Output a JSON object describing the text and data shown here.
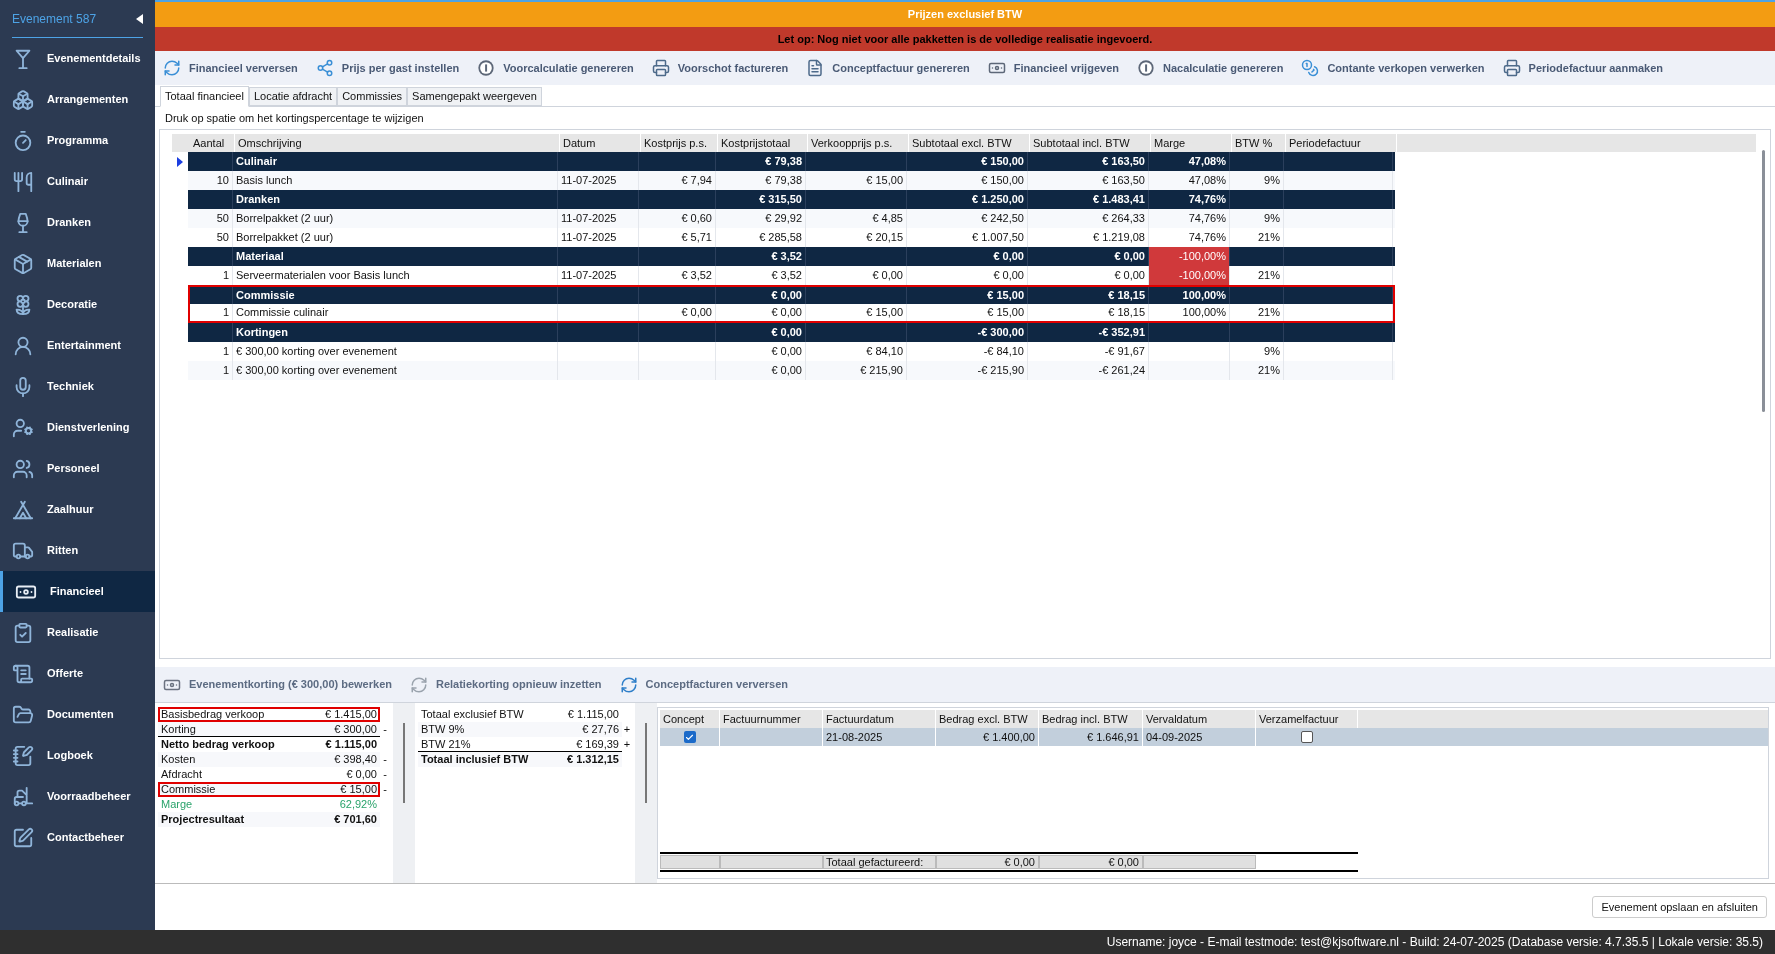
{
  "banner": {
    "title": "Prijzen exclusief BTW"
  },
  "warning": "Let op: Nog niet voor alle pakketten is de volledige realisatie ingevoerd.",
  "sidebar": {
    "title": "Evenement 587",
    "items": [
      {
        "label": "Evenementdetails",
        "selected": false
      },
      {
        "label": "Arrangementen",
        "selected": false
      },
      {
        "label": "Programma",
        "selected": false
      },
      {
        "label": "Culinair",
        "selected": false
      },
      {
        "label": "Dranken",
        "selected": false
      },
      {
        "label": "Materialen",
        "selected": false
      },
      {
        "label": "Decoratie",
        "selected": false
      },
      {
        "label": "Entertainment",
        "selected": false
      },
      {
        "label": "Techniek",
        "selected": false
      },
      {
        "label": "Dienstverlening",
        "selected": false
      },
      {
        "label": "Personeel",
        "selected": false
      },
      {
        "label": "Zaalhuur",
        "selected": false
      },
      {
        "label": "Ritten",
        "selected": false
      },
      {
        "label": "Financieel",
        "selected": true
      },
      {
        "label": "Realisatie",
        "selected": false
      },
      {
        "label": "Offerte",
        "selected": false
      },
      {
        "label": "Documenten",
        "selected": false
      },
      {
        "label": "Logboek",
        "selected": false
      },
      {
        "label": "Voorraadbeheer",
        "selected": false
      },
      {
        "label": "Contactbeheer",
        "selected": false
      }
    ]
  },
  "toolbar": [
    "Financieel verversen",
    "Prijs per gast instellen",
    "Voorcalculatie genereren",
    "Voorschot factureren",
    "Conceptfactuur genereren",
    "Financieel vrijgeven",
    "Nacalculatie genereren",
    "Contante verkopen verwerken",
    "Periodefactuur aanmaken"
  ],
  "tabs": [
    {
      "label": "Totaal financieel",
      "selected": true
    },
    {
      "label": "Locatie afdracht",
      "selected": false
    },
    {
      "label": "Commissies",
      "selected": false
    },
    {
      "label": "Samengepakt weergeven",
      "selected": false
    }
  ],
  "hint": "Druk op spatie om het kortingspercentage te wijzigen",
  "table": {
    "columns": [
      "Aantal",
      "Omschrijving",
      "Datum",
      "Kostprijs p.s.",
      "Kostprijstotaal",
      "Verkoopprijs p.s.",
      "Subtotaal excl. BTW",
      "Subtotaal incl. BTW",
      "Marge",
      "BTW %",
      "Periodefactuur"
    ],
    "rows": [
      {
        "kind": "group",
        "current": true,
        "outlined": false,
        "marge_alert": false,
        "cells": [
          null,
          "Culinair",
          null,
          null,
          "€ 79,38",
          null,
          "€ 150,00",
          "€ 163,50",
          "47,08%",
          null,
          null
        ]
      },
      {
        "kind": "item",
        "current": false,
        "outlined": false,
        "marge_alert": false,
        "cells": [
          "10",
          "Basis lunch",
          "11-07-2025",
          "€ 7,94",
          "€ 79,38",
          "€ 15,00",
          "€ 150,00",
          "€ 163,50",
          "47,08%",
          "9%",
          null
        ]
      },
      {
        "kind": "group",
        "current": false,
        "outlined": false,
        "marge_alert": false,
        "cells": [
          null,
          "Dranken",
          null,
          null,
          "€ 315,50",
          null,
          "€ 1.250,00",
          "€ 1.483,41",
          "74,76%",
          null,
          null
        ]
      },
      {
        "kind": "item",
        "current": false,
        "outlined": false,
        "marge_alert": false,
        "cells": [
          "50",
          "Borrelpakket (2 uur)",
          "11-07-2025",
          "€ 0,60",
          "€ 29,92",
          "€ 4,85",
          "€ 242,50",
          "€ 264,33",
          "74,76%",
          "9%",
          null
        ]
      },
      {
        "kind": "item",
        "current": false,
        "outlined": false,
        "marge_alert": false,
        "cells": [
          "50",
          "Borrelpakket (2 uur)",
          "11-07-2025",
          "€ 5,71",
          "€ 285,58",
          "€ 20,15",
          "€ 1.007,50",
          "€ 1.219,08",
          "74,76%",
          "21%",
          null
        ]
      },
      {
        "kind": "group",
        "current": false,
        "outlined": false,
        "marge_alert": true,
        "cells": [
          null,
          "Materiaal",
          null,
          null,
          "€ 3,52",
          null,
          "€ 0,00",
          "€ 0,00",
          "-100,00%",
          null,
          null
        ]
      },
      {
        "kind": "item",
        "current": false,
        "outlined": false,
        "marge_alert": true,
        "cells": [
          "1",
          "Serveermaterialen voor Basis lunch",
          "11-07-2025",
          "€ 3,52",
          "€ 3,52",
          "€ 0,00",
          "€ 0,00",
          "€ 0,00",
          "-100,00%",
          "21%",
          null
        ]
      },
      {
        "kind": "group",
        "current": false,
        "outlined": true,
        "marge_alert": false,
        "cells": [
          null,
          "Commissie",
          null,
          null,
          "€ 0,00",
          null,
          "€ 15,00",
          "€ 18,15",
          "100,00%",
          null,
          null
        ]
      },
      {
        "kind": "item",
        "current": false,
        "outlined": true,
        "marge_alert": false,
        "cells": [
          "1",
          "Commissie culinair",
          null,
          "€ 0,00",
          "€ 0,00",
          "€ 15,00",
          "€ 15,00",
          "€ 18,15",
          "100,00%",
          "21%",
          null
        ]
      },
      {
        "kind": "group",
        "current": false,
        "outlined": false,
        "marge_alert": false,
        "cells": [
          null,
          "Kortingen",
          null,
          null,
          "€ 0,00",
          null,
          "-€ 300,00",
          "-€ 352,91",
          null,
          null,
          null
        ]
      },
      {
        "kind": "item",
        "current": false,
        "outlined": false,
        "marge_alert": false,
        "cells": [
          "1",
          "€ 300,00 korting over evenement",
          null,
          null,
          "€ 0,00",
          "€ 84,10",
          "-€ 84,10",
          "-€ 91,67",
          null,
          "9%",
          null
        ]
      },
      {
        "kind": "item",
        "current": false,
        "outlined": false,
        "marge_alert": false,
        "cells": [
          "1",
          "€ 300,00 korting over evenement",
          null,
          null,
          "€ 0,00",
          "€ 215,90",
          "-€ 215,90",
          "-€ 261,24",
          null,
          "21%",
          null
        ]
      }
    ]
  },
  "bottom_toolbar": [
    "Evenementkorting (€ 300,00) bewerken",
    "Relatiekorting opnieuw inzetten",
    "Conceptfacturen verversen"
  ],
  "summary": [
    {
      "label": "Basisbedrag verkoop",
      "value": "€ 1.415,00",
      "kind": "normal",
      "outlined": true,
      "rule_below": false
    },
    {
      "label": "Korting",
      "value": "€ 300,00",
      "sign": "-",
      "kind": "normal",
      "outlined": false,
      "rule_below": true
    },
    {
      "label": "Netto bedrag verkoop",
      "value": "€ 1.115,00",
      "kind": "total",
      "outlined": false,
      "rule_below": false
    },
    {
      "label": "Kosten",
      "value": "€ 398,40",
      "sign": "-",
      "kind": "normal",
      "outlined": false,
      "rule_below": false
    },
    {
      "label": "Afdracht",
      "value": "€ 0,00",
      "sign": "-",
      "kind": "normal",
      "outlined": false,
      "rule_below": false
    },
    {
      "label": "Commissie",
      "value": "€ 15,00",
      "sign": "-",
      "kind": "normal",
      "outlined": true,
      "rule_below": false
    },
    {
      "label": "Marge",
      "value": "62,92%",
      "kind": "margin",
      "outlined": false,
      "rule_below": false
    },
    {
      "label": "Projectresultaat",
      "value": "€ 701,60",
      "kind": "total",
      "outlined": false,
      "rule_below": false
    }
  ],
  "vat_summary": [
    {
      "label": "Totaal exclusief BTW",
      "value": "€ 1.115,00",
      "kind": "normal",
      "outlined": false,
      "rule_below": false
    },
    {
      "label": "BTW 9%",
      "value": "€ 27,76",
      "sign": "+",
      "kind": "normal",
      "outlined": false,
      "rule_below": false
    },
    {
      "label": "BTW 21%",
      "value": "€ 169,39",
      "sign": "+",
      "kind": "normal",
      "outlined": false,
      "rule_below": true
    },
    {
      "label": "Totaal inclusief BTW",
      "value": "€ 1.312,15",
      "kind": "total",
      "outlined": false,
      "rule_below": false
    }
  ],
  "invoices": {
    "columns": [
      "Concept",
      "Factuurnummer",
      "Factuurdatum",
      "Bedrag excl. BTW",
      "Bedrag incl. BTW",
      "Vervaldatum",
      "Verzamelfactuur"
    ],
    "rows": [
      {
        "selected": true,
        "concept": true,
        "factuurdatum": "21-08-2025",
        "bedrag_excl": "€ 1.400,00",
        "bedrag_incl": "€ 1.646,91",
        "vervaldatum": "04-09-2025",
        "verzamelfactuur": false
      }
    ],
    "footer": {
      "label": "Totaal gefactureerd:",
      "bedrag_excl": "€ 0,00",
      "bedrag_incl": "€ 0,00"
    }
  },
  "save_button": "Evenement opslaan en afsluiten",
  "status_bar": "Username: joyce - E-mail testmode: test@kjsoftware.nl - Build: 24-07-2025 (Database versie: 4.7.35.5 | Lokale versie: 35.5)"
}
